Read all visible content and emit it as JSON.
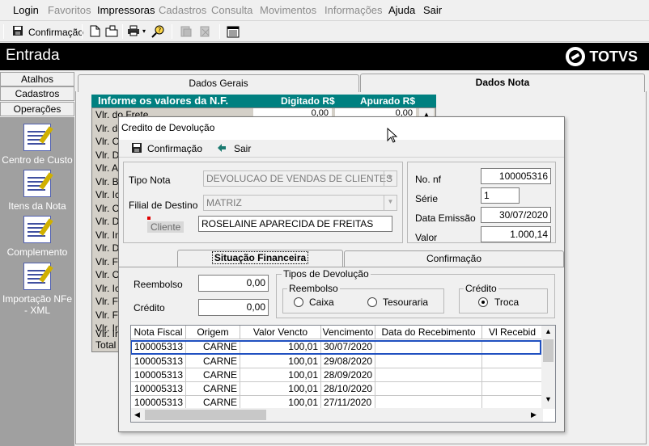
{
  "menu": {
    "items": [
      {
        "label": "Login",
        "disabled": false
      },
      {
        "label": "Favoritos",
        "disabled": true
      },
      {
        "label": "Impressoras",
        "disabled": false
      },
      {
        "label": "Cadastros",
        "disabled": true
      },
      {
        "label": "Consulta",
        "disabled": true
      },
      {
        "label": "Movimentos",
        "disabled": true
      },
      {
        "label": "Informações",
        "disabled": true
      },
      {
        "label": "Ajuda",
        "disabled": false
      },
      {
        "label": "Sair",
        "disabled": false
      }
    ]
  },
  "toolbar": {
    "confirm_label": "Confirmação"
  },
  "window": {
    "title": "Entrada",
    "brand": "TOTVS"
  },
  "left_panel": {
    "buttons": [
      "Atalhos",
      "Cadastros",
      "Operações"
    ],
    "operations": [
      "Centro de Custo",
      "Itens da Nota",
      "Complemento",
      "Importação NFe - XML"
    ]
  },
  "main_tabs": [
    "Dados Gerais",
    "Dados Nota"
  ],
  "background_form": {
    "header": {
      "title": "Informe os valores da N.F.",
      "col1": "Digitado R$",
      "col2": "Apurado R$"
    },
    "first_row": {
      "label": "Vlr. do Frete",
      "digitado": "0,00",
      "apurado": "0,00"
    },
    "row_labels": [
      "Vlr. do Frete",
      "Vlr. do",
      "Vlr. Ou",
      "Vlr. De",
      "Vlr. Ac",
      "Vlr. Ba",
      "Vlr. Icr",
      "Vlr. Co",
      "Vlr. De",
      "Vlr. Inc",
      "Vlr. De",
      "Vlr. Fu",
      "Vlr. CD",
      "Vlr. Icr",
      "Vlr. FE",
      "Vlr. FE",
      "Vlr. Inc",
      "Vlr. Inc",
      "Total N"
    ]
  },
  "dialog": {
    "title": "Credito de Devolução",
    "toolbar": {
      "confirm": "Confirmação",
      "exit": "Sair"
    },
    "tipo_nota": {
      "label": "Tipo Nota",
      "value": "DEVOLUCAO DE VENDAS DE CLIENTES"
    },
    "filial": {
      "label": "Filial de Destino",
      "value": "MATRIZ"
    },
    "cliente": {
      "label": "Cliente",
      "value": "ROSELAINE APARECIDA DE FREITAS"
    },
    "no_nf": {
      "label": "No. nf",
      "value": "100005316"
    },
    "serie": {
      "label": "Série",
      "value": "1"
    },
    "data_emissao": {
      "label": "Data Emissão",
      "value": "30/07/2020"
    },
    "valor": {
      "label": "Valor",
      "value": "1.000,14"
    },
    "tabs": [
      "Situação Financeira",
      "Confirmação"
    ],
    "reembolso": {
      "label": "Reembolso",
      "value": "0,00"
    },
    "credito": {
      "label": "Crédito",
      "value": "0,00"
    },
    "tipos_devolucao": {
      "title": "Tipos de Devolução",
      "reembolso_group": "Reembolso",
      "caixa": "Caixa",
      "tesouraria": "Tesouraria",
      "credito_group": "Crédito",
      "troca": "Troca"
    },
    "grid": {
      "columns": [
        "Nota Fiscal",
        "Origem",
        "Valor Vencto",
        "Vencimento",
        "Data do Recebimento",
        "Vl Recebid"
      ],
      "rows": [
        [
          "100005313",
          "CARNE",
          "100,01",
          "30/07/2020",
          "",
          ""
        ],
        [
          "100005313",
          "CARNE",
          "100,01",
          "29/08/2020",
          "",
          ""
        ],
        [
          "100005313",
          "CARNE",
          "100,01",
          "28/09/2020",
          "",
          ""
        ],
        [
          "100005313",
          "CARNE",
          "100,01",
          "28/10/2020",
          "",
          ""
        ],
        [
          "100005313",
          "CARNE",
          "100,01",
          "27/11/2020",
          "",
          ""
        ]
      ]
    }
  }
}
